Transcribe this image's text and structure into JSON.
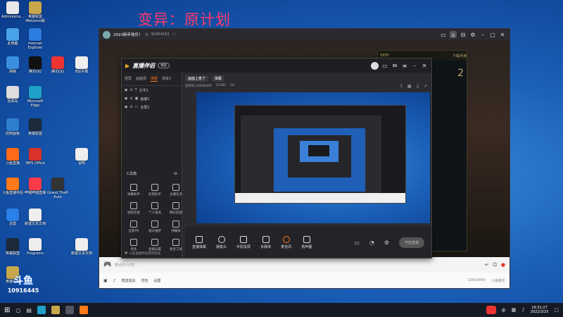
{
  "overlay_title": "变异：原计划",
  "desktop_icons": [
    {
      "label": "Administra...",
      "color": "#e8e8e8"
    },
    {
      "label": "英雄联盟 WeGame版",
      "color": "#c8a84a"
    },
    {
      "label": "此电脑",
      "color": "#4aa3e8"
    },
    {
      "label": "Internet Explorer",
      "color": "#2d7ce0"
    },
    {
      "label": "网络",
      "color": "#3a8fe0"
    },
    {
      "label": "腾讯QQ",
      "color": "#111111"
    },
    {
      "label": "腾讯QQ",
      "color": "#ee3333"
    },
    {
      "label": "B站字幕",
      "color": "#eeeeee"
    },
    {
      "label": "回收站",
      "color": "#dddddd"
    },
    {
      "label": "Microsoft Edge",
      "color": "#1fa0c8"
    },
    {
      "label": "控制面板",
      "color": "#2f7fd0"
    },
    {
      "label": "英雄联盟",
      "color": "#1c2a3a"
    },
    {
      "label": "斗鱼直播",
      "color": "#ff6a1a"
    },
    {
      "label": "WPS Office",
      "color": "#d8322a"
    },
    {
      "label": "说明",
      "color": "#eeeeee"
    },
    {
      "label": "斗鱼直播伴侣",
      "color": "#ff7a1a"
    },
    {
      "label": "哔哩哔哩直播",
      "color": "#ff3b4b"
    },
    {
      "label": "Grand Theft Auto",
      "color": "#333333"
    },
    {
      "label": "迅雷",
      "color": "#2a7fe8"
    },
    {
      "label": "新建文本文档",
      "color": "#eeeeee"
    },
    {
      "label": "英雄联盟",
      "color": "#1c2a3a"
    },
    {
      "label": "Programs",
      "color": "#eeeeee"
    },
    {
      "label": "新建文本文档",
      "color": "#eeeeee"
    },
    {
      "label": "英雄联盟",
      "color": "#c8a84a"
    }
  ],
  "stream_window": {
    "title": "2023新年快乐！",
    "room_id": "92454263"
  },
  "league_panel": {
    "score": "5950",
    "right_text": "下载手游",
    "big_num": "2",
    "list": [
      "全部好友",
      "近期队友"
    ]
  },
  "companion": {
    "brand": "直播伴侣",
    "mode": "横屏",
    "tabs": [
      "竖屏",
      "画面源",
      "场景",
      "场景2"
    ],
    "sources": [
      "文字1",
      "画面1",
      "全屏1"
    ],
    "tools_header": "工具箱",
    "tools": [
      "弹幕助手",
      "房管助手",
      "主播任务",
      "视频连麦",
      "个人道具",
      "精彩回放",
      "连麦PK",
      "观众抽奖",
      "弹幕屏",
      "更多",
      "直播设置",
      "更多工具"
    ],
    "bottom_tip": "斗鱼直播伴侣使用帮助",
    "topline_tabs": [
      "画面上麦了",
      "弹幕"
    ],
    "room_line": "房间号:10916445",
    "stats": [
      "21582",
      "56"
    ],
    "bottom_buttons": [
      "直播弹幕",
      "摄像头",
      "手机投屏",
      "多媒体",
      "麦克风",
      "扬声器"
    ],
    "start_btn": "开始直播"
  },
  "chat": {
    "placeholder": "聊点什么吧...",
    "icons": [
      "弹幕",
      "表情",
      "礼物"
    ],
    "bottom_labels": [
      "赠送道具",
      "背包",
      "设置"
    ],
    "room_no": "10916445",
    "corner": "斗鱼娱乐"
  },
  "watermark": {
    "brand": "斗鱼",
    "id": "10916445"
  },
  "taskbar": {
    "time": "19:31:27",
    "date": "2022/3/25",
    "ime": "中"
  }
}
